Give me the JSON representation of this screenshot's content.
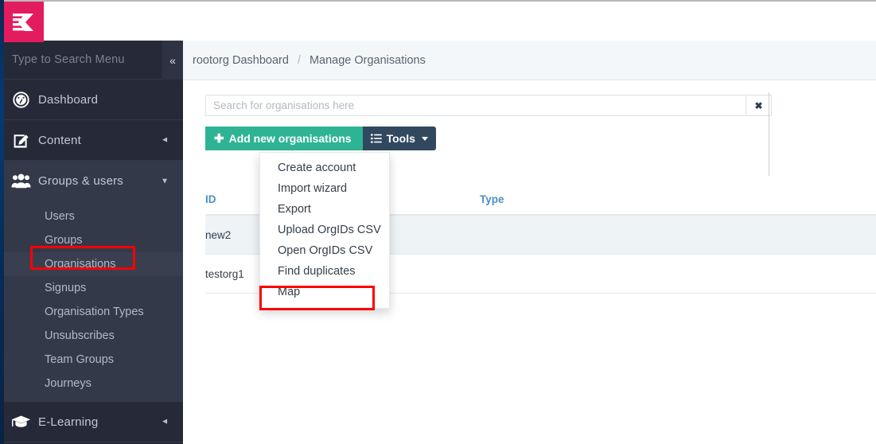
{
  "brand": {
    "logo_icon": "k-logo-icon",
    "logo_color": "#e31c5f",
    "accent_teal": "#2eb494",
    "accent_navy": "#31495f",
    "highlight_color": "#fe0000",
    "link_blue": "#4a90c4"
  },
  "sidebar": {
    "search_placeholder": "Type to Search Menu",
    "collapse_icon": "«",
    "groups": [
      {
        "label": "Dashboard",
        "icon": "dashboard-gauge-icon",
        "caret": ""
      },
      {
        "label": "Content",
        "icon": "edit-pencil-square-icon",
        "caret": "◄"
      },
      {
        "label": "Groups & users",
        "icon": "users-group-icon",
        "caret": "▼"
      },
      {
        "label": "E-Learning",
        "icon": "graduation-cap-icon",
        "caret": "◄"
      }
    ],
    "sub_items": [
      {
        "label": "Users",
        "selected": false
      },
      {
        "label": "Groups",
        "selected": false
      },
      {
        "label": "Organisations",
        "selected": true
      },
      {
        "label": "Signups",
        "selected": false
      },
      {
        "label": "Organisation Types",
        "selected": false
      },
      {
        "label": "Unsubscribes",
        "selected": false
      },
      {
        "label": "Team Groups",
        "selected": false
      },
      {
        "label": "Journeys",
        "selected": false
      }
    ]
  },
  "breadcrumb": {
    "root": "rootorg Dashboard",
    "separator": "/",
    "current": "Manage Organisations"
  },
  "search": {
    "value": "",
    "placeholder": "Search for organisations here",
    "clear_icon": "✖"
  },
  "toolbar": {
    "add_label": "Add new organisations",
    "add_icon": "plus-icon",
    "tools_label": "Tools",
    "tools_icon": "list-lines-icon",
    "tools_caret": "caret-down-icon"
  },
  "dropdown": {
    "open": true,
    "items": [
      {
        "label": "Create account",
        "highlighted": false
      },
      {
        "label": "Import wizard",
        "highlighted": false
      },
      {
        "label": "Export",
        "highlighted": false
      },
      {
        "label": "Upload OrgIDs CSV",
        "highlighted": false
      },
      {
        "label": "Open OrgIDs CSV",
        "highlighted": false
      },
      {
        "label": "Find duplicates",
        "highlighted": false
      },
      {
        "label": "Map",
        "highlighted": true
      }
    ]
  },
  "table": {
    "columns": [
      {
        "key": "id",
        "label": "ID"
      },
      {
        "key": "type",
        "label": "Type"
      }
    ],
    "rows": [
      {
        "id": "new2",
        "type": ""
      },
      {
        "id": "testorg1",
        "type": ""
      }
    ]
  }
}
